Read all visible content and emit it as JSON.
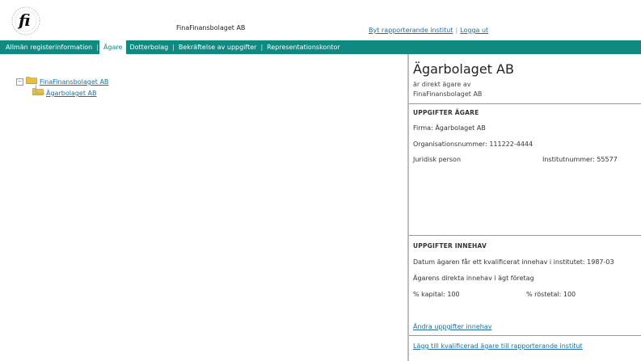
{
  "header": {
    "logo_text": "fi",
    "company": "FinaFinansbolaget AB",
    "link_switch": "Byt rapporterande institut",
    "link_separator": "|",
    "link_logout": "Logga ut"
  },
  "nav": {
    "items": [
      {
        "label": "Allmän registerinformation",
        "active": false
      },
      {
        "label": "Ägare",
        "active": true
      },
      {
        "label": "Dotterbolag",
        "active": false
      },
      {
        "label": "Bekräftelse av uppgifter",
        "active": false
      },
      {
        "label": "Representationskontor",
        "active": false
      }
    ],
    "separator": "|"
  },
  "tree": {
    "root_label": "FinaFinansbolaget AB",
    "child_label": "Ägarbolaget AB",
    "expander": "−"
  },
  "panel": {
    "title": "Ägarbolaget AB",
    "subtitle1": "är direkt ägare av",
    "subtitle2": "FinaFinansbolaget AB",
    "owner_section": {
      "heading": "UPPGIFTER ÄGARE",
      "firma": "Firma: Ägarbolaget AB",
      "orgnr": "Organisationsnummer: 111222-4444",
      "person_type": "Juridisk person",
      "institutnummer": "Institutnummer: 55577"
    },
    "holding_section": {
      "heading": "UPPGIFTER INNEHAV",
      "datum": "Datum ägaren får ett kvalificerat innehav i institutet: 1987-03",
      "direct": "Ägarens direkta innehav i ägt företag",
      "kapital": "% kapital: 100",
      "rostetal": "% röstetal: 100"
    },
    "link_change": "Ändra uppgifter innehav",
    "link_add": "Lägg till kvalificerad ägare till rapporterande institut"
  },
  "colors": {
    "nav_bg": "#0e8a80",
    "link": "#1a6fa8",
    "folder": "#e8c040"
  }
}
